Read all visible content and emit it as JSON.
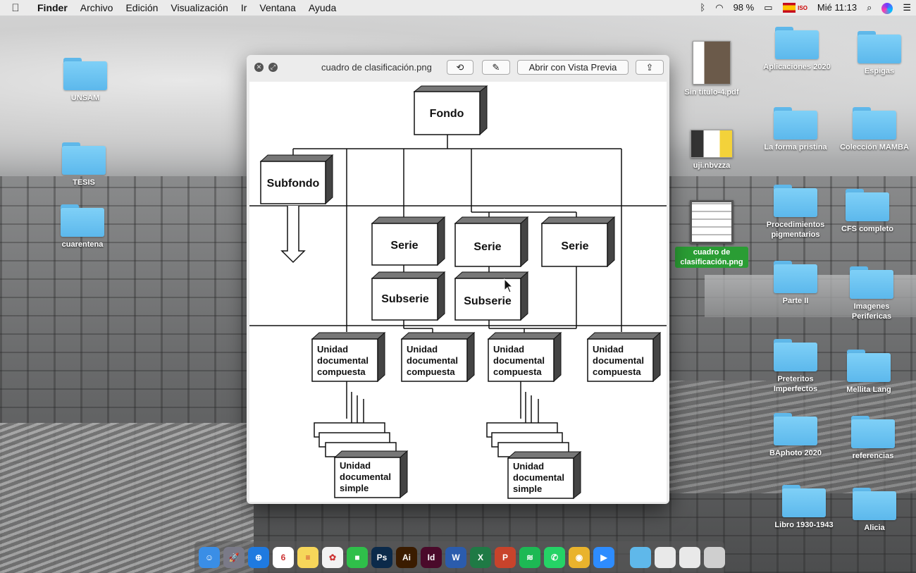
{
  "menubar": {
    "app_name": "Finder",
    "items": [
      "Archivo",
      "Edición",
      "Visualización",
      "Ir",
      "Ventana",
      "Ayuda"
    ],
    "battery": "98 %",
    "keyboard": "ISO",
    "clock": "Mié 11:13"
  },
  "desktop_left": [
    {
      "label": "UNSAM"
    },
    {
      "label": "TESIS"
    },
    {
      "label": "cuarentena"
    }
  ],
  "desktop_files": [
    {
      "label": "Sin título-4.pdf"
    },
    {
      "label": "uji.nbvzza"
    },
    {
      "label": "cuadro de clasificación.png"
    }
  ],
  "desktop_right": [
    {
      "label": "Aplicaciones 2020"
    },
    {
      "label": "Espigas"
    },
    {
      "label": "La forma pristina"
    },
    {
      "label": "Colección MAMBA"
    },
    {
      "label": "Procedimientos pigmentarios"
    },
    {
      "label": "CFS completo"
    },
    {
      "label": "Parte II"
    },
    {
      "label": "Imagenes Perifericas"
    },
    {
      "label": "Preteritos Imperfectos"
    },
    {
      "label": "Mellita Lang"
    },
    {
      "label": "BAphoto 2020"
    },
    {
      "label": "referencias"
    },
    {
      "label": "Libro 1930-1943"
    },
    {
      "label": "Alicia"
    }
  ],
  "quicklook": {
    "filename": "cuadro de clasificación.png",
    "open_button": "Abrir con Vista Previa"
  },
  "diagram": {
    "fondo": "Fondo",
    "subfondo": "Subfondo",
    "serie": "Serie",
    "subserie": "Subserie",
    "udc_line1": "Unidad",
    "udc_line2": "documental",
    "udc_line3": "compuesta",
    "uds_line3": "simple"
  },
  "dock": {
    "apps": [
      {
        "name": "finder",
        "glyph": "☺",
        "color": "#3a8ee6"
      },
      {
        "name": "launchpad",
        "glyph": "🚀",
        "color": "#7a7a88"
      },
      {
        "name": "safari",
        "glyph": "⊕",
        "color": "#1f7ae0"
      },
      {
        "name": "calendar",
        "glyph": "6",
        "color": "#ffffff"
      },
      {
        "name": "notes",
        "glyph": "≡",
        "color": "#f6d65a"
      },
      {
        "name": "photos",
        "glyph": "✿",
        "color": "#f2f2f2"
      },
      {
        "name": "facetime",
        "glyph": "■",
        "color": "#2fbf4a"
      },
      {
        "name": "photoshop",
        "glyph": "Ps",
        "color": "#0b2a4a"
      },
      {
        "name": "illustrator",
        "glyph": "Ai",
        "color": "#3a1c00"
      },
      {
        "name": "indesign",
        "glyph": "Id",
        "color": "#4a0a2a"
      },
      {
        "name": "word",
        "glyph": "W",
        "color": "#2b5cad"
      },
      {
        "name": "excel",
        "glyph": "X",
        "color": "#1f7a45"
      },
      {
        "name": "powerpoint",
        "glyph": "P",
        "color": "#c8432b"
      },
      {
        "name": "spotify",
        "glyph": "≋",
        "color": "#1db954"
      },
      {
        "name": "whatsapp",
        "glyph": "✆",
        "color": "#25d366"
      },
      {
        "name": "chrome",
        "glyph": "◉",
        "color": "#e9b32c"
      },
      {
        "name": "zoom",
        "glyph": "▶",
        "color": "#2d8cff"
      }
    ]
  }
}
